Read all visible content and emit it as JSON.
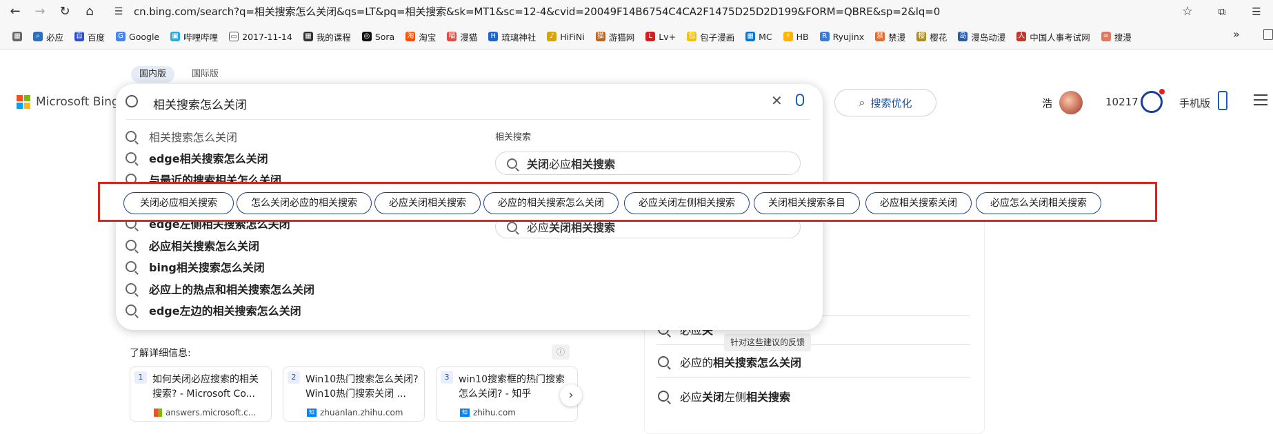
{
  "browser": {
    "url": "cn.bing.com/search?q=相关搜索怎么关闭&qs=LT&pq=相关搜索&sk=MT1&sc=12-4&cvid=20049F14B6754C4CA2F1475D25D2D199&FORM=QBRE&sp=2&lq=0",
    "bookmarks": [
      "必应",
      "百度",
      "Google",
      "哔哩哔哩",
      "2017-11-14",
      "我的课程",
      "Sora",
      "淘宝",
      "漫猫",
      "琉璃神社",
      "HiFiNi",
      "游猫网",
      "Lv+",
      "包子漫画",
      "MC",
      "HB",
      "Ryujinx",
      "禁漫",
      "樱花",
      "漫岛动漫",
      "中国人事考试网",
      "搜漫"
    ]
  },
  "scope": {
    "domestic": "国内版",
    "international": "国际版"
  },
  "logo": {
    "text": "Microsoft Bing"
  },
  "search": {
    "query": "相关搜索怎么关闭",
    "suggestions": [
      {
        "pre": "",
        "bold": "",
        "post": "相关搜索怎么关闭"
      },
      {
        "pre": "",
        "bold": "edge相关搜索怎么关闭",
        "post": ""
      },
      {
        "pre": "",
        "bold": "与最近的搜索相关怎么关闭",
        "post": ""
      },
      {
        "pre": "",
        "bold": "edge左侧相关搜索怎么关闭",
        "post": ""
      },
      {
        "pre": "",
        "bold": "必应相关搜索怎么关闭",
        "post": ""
      },
      {
        "pre": "",
        "bold": "bing相关搜索怎么关闭",
        "post": ""
      },
      {
        "pre": "",
        "bold": "必应上的热点和相关搜索怎么关闭",
        "post": ""
      },
      {
        "pre": "",
        "bold": "edge左边的相关搜索怎么关闭",
        "post": ""
      }
    ],
    "related_title": "相关搜索",
    "related": [
      {
        "a": "关闭",
        "b": "必应",
        "c": "相关搜索"
      },
      {
        "a": "必应",
        "b": "关闭相关搜索",
        "c": ""
      }
    ]
  },
  "header": {
    "optimize": "搜索优化",
    "user": "浩",
    "points": "10217",
    "mobile": "手机版"
  },
  "chips": [
    "关闭必应相关搜索",
    "怎么关闭必应的相关搜索",
    "必应关闭相关搜索",
    "必应的相关搜索怎么关闭",
    "必应关闭左侧相关搜索",
    "关闭相关搜索条目",
    "必应相关搜索关闭",
    "必应怎么关闭相关搜索"
  ],
  "learn": {
    "title": "了解详细信息:",
    "cards": [
      {
        "num": "1",
        "title": "如何关闭必应搜索的相关搜索? - Microsoft Co...",
        "source": "answers.microsoft.c..."
      },
      {
        "num": "2",
        "title": "Win10热门搜索怎么关闭? Win10热门搜索关闭 ...",
        "source": "zhuanlan.zhihu.com"
      },
      {
        "num": "3",
        "title": "win10搜索框的热门搜索怎么关闭? - 知乎",
        "source": "zhihu.com"
      }
    ]
  },
  "right_rows": [
    {
      "a": "必应",
      "b": "关",
      "c": ""
    },
    {
      "a": "必应的",
      "b": "相关搜索怎么关闭",
      "c": ""
    },
    {
      "a": "必应",
      "b": "关闭",
      "c": "左侧",
      "d": "相关搜索"
    }
  ],
  "tooltip": "针对这些建议的反馈"
}
